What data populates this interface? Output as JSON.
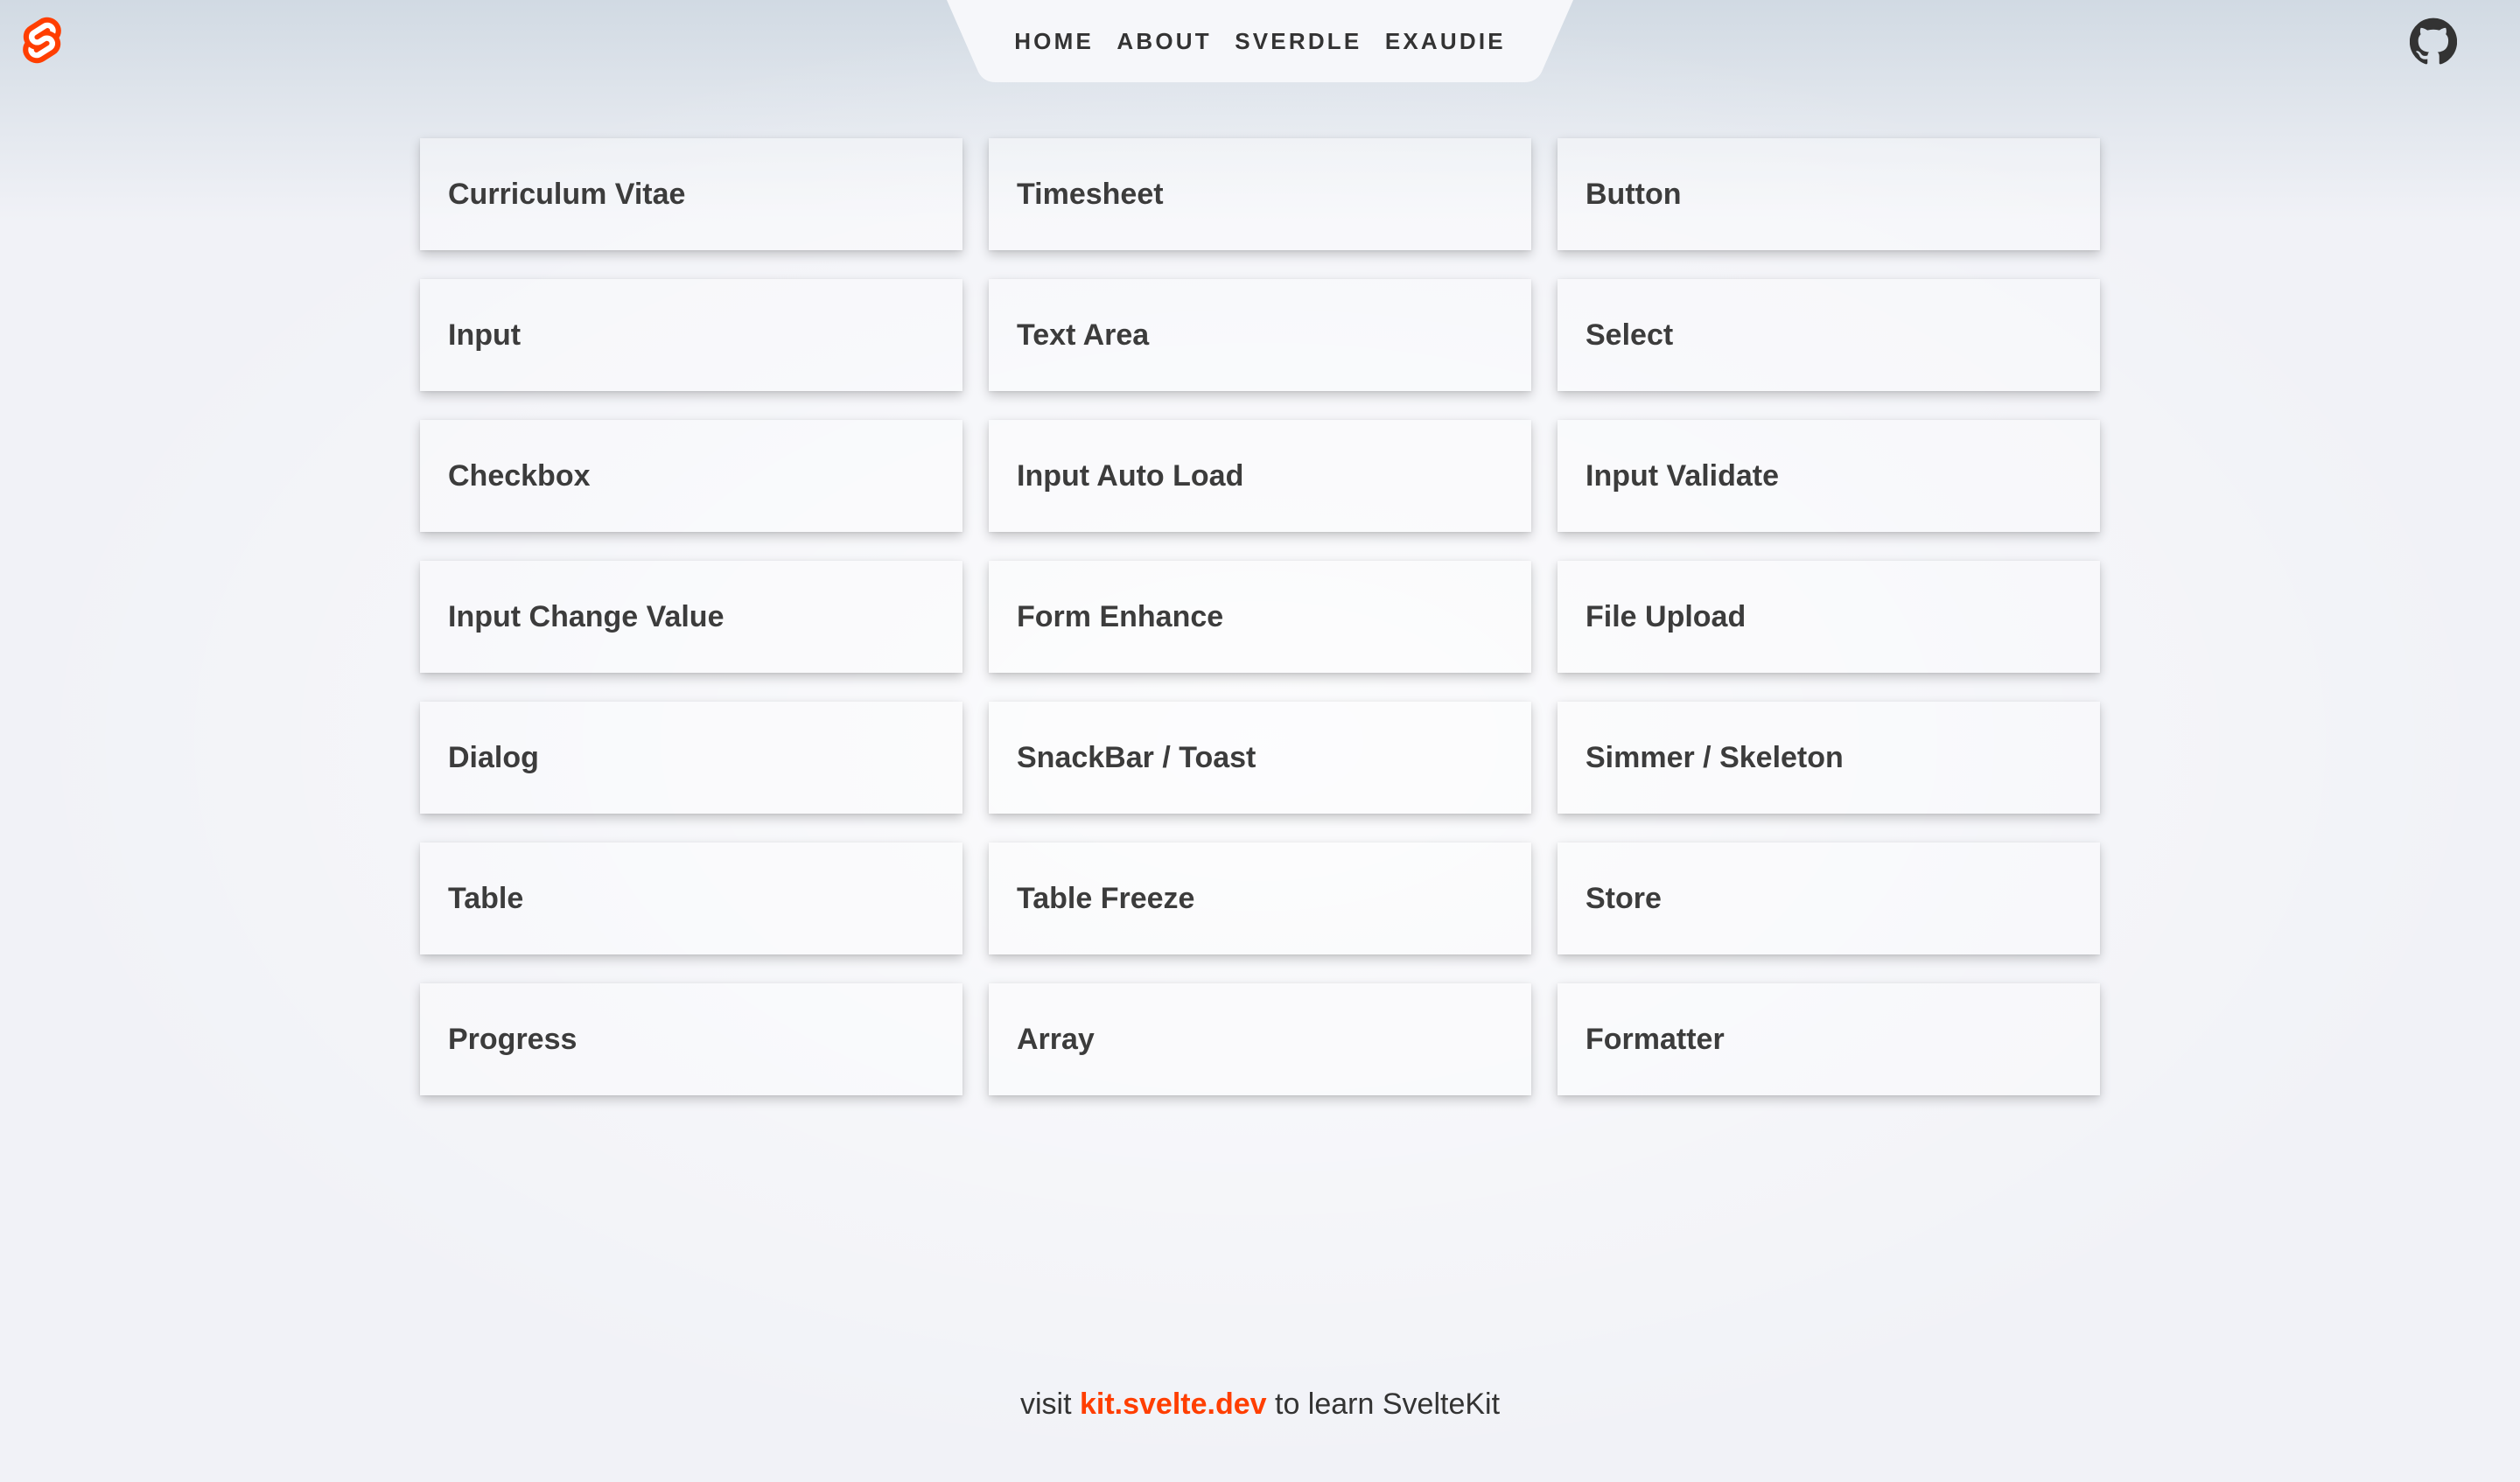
{
  "header": {
    "logo_icon": "svelte-logo-icon",
    "github_icon": "github-icon",
    "nav": [
      {
        "label": "Home",
        "active": false
      },
      {
        "label": "About",
        "active": false
      },
      {
        "label": "Sverdle",
        "active": false
      },
      {
        "label": "Exaudie",
        "active": true
      }
    ]
  },
  "cards": [
    "Curriculum Vitae",
    "Timesheet",
    "Button",
    "Input",
    "Text Area",
    "Select",
    "Checkbox",
    "Input Auto Load",
    "Input Validate",
    "Input Change Value",
    "Form Enhance",
    "File Upload",
    "Dialog",
    "SnackBar / Toast",
    "Simmer / Skeleton",
    "Table",
    "Table Freeze",
    "Store",
    "Progress",
    "Array",
    "Formatter"
  ],
  "footer": {
    "prefix": "visit",
    "link_text": "kit.svelte.dev",
    "suffix": "to learn SvelteKit"
  },
  "colors": {
    "accent": "#ff3e00",
    "text": "#333333",
    "nav_background": "#f6f7fa"
  }
}
